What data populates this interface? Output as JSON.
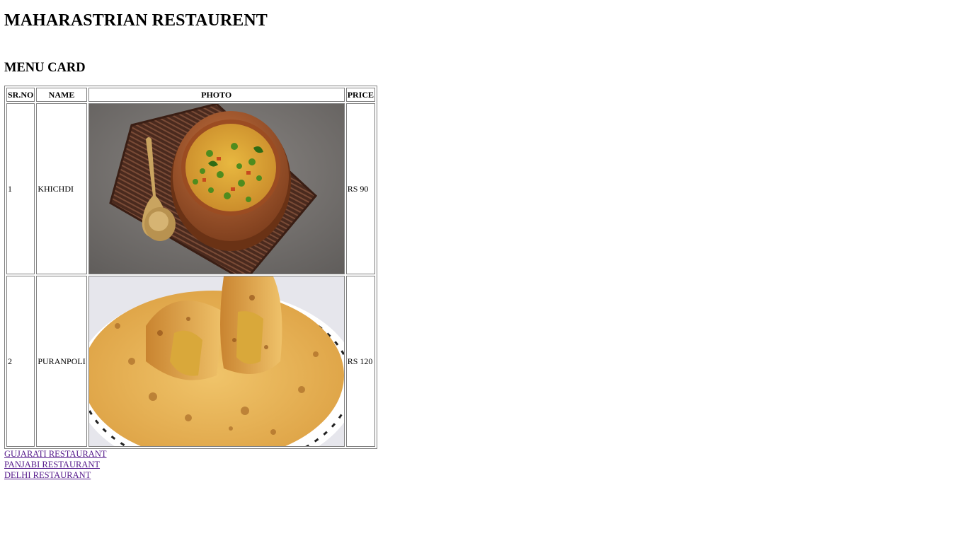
{
  "page": {
    "title": "MAHARASTRIAN RESTAURENT",
    "subtitle": "MENU CARD"
  },
  "table": {
    "headers": [
      "SR.NO",
      "NAME",
      "PHOTO",
      "PRICE"
    ],
    "rows": [
      {
        "sr": "1",
        "name": "KHICHDI",
        "photo_icon": "khichdi-photo",
        "price": "RS 90"
      },
      {
        "sr": "2",
        "name": "PURANPOLI",
        "photo_icon": "puranpoli-photo",
        "price": "RS 120"
      }
    ]
  },
  "links": [
    {
      "label": "GUJARATI RESTAURANT"
    },
    {
      "label": "PANJABI RESTAURANT"
    },
    {
      "label": "DELHI RESTAURANT"
    }
  ],
  "colors": {
    "visited_link": "#551a8b",
    "table_border": "#808080"
  }
}
